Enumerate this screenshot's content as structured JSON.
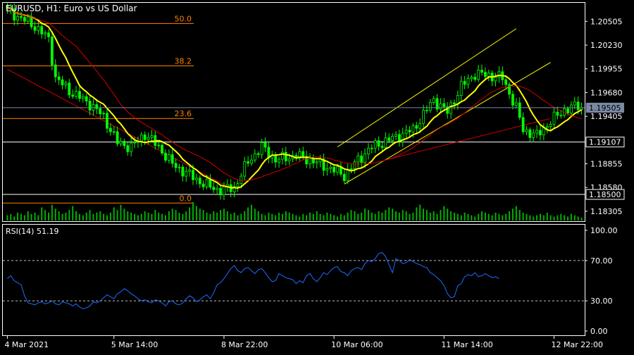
{
  "header": {
    "symbol": "EURUSD",
    "timeframe": "H1",
    "description": "Euro vs US Dollar"
  },
  "colors": {
    "background": "#000000",
    "frame": "#ffffff",
    "bull_candle": "#00ff00",
    "bear_candle": "#00ff00",
    "ma_fast": "#ffff00",
    "ma_slow": "#d40000",
    "fibo": "#ff8000",
    "channel": "#ffff00",
    "regression": "#d40000",
    "hline": "#ffffff",
    "current_price_line": "#7a8aa6",
    "volume": "#00b000",
    "rsi": "#1e6cff",
    "rsi_levels": "#c0c0c0"
  },
  "chart_data": [
    {
      "type": "candlestick",
      "title": "EURUSD, H1:  Euro vs US Dollar",
      "y_ticks": [
        "1.20505",
        "1.20230",
        "1.19955",
        "1.19680",
        "1.19405",
        "1.18855",
        "1.18580",
        "1.18305"
      ],
      "ylim": [
        1.1819,
        1.2072
      ],
      "x_ticks": [
        "4 Mar 2021",
        "5 Mar 14:00",
        "8 Mar 22:00",
        "10 Mar 06:00",
        "11 Mar 14:00",
        "12 Mar 22:00"
      ],
      "x_tick_index": [
        0,
        31,
        63,
        95,
        127,
        159
      ],
      "bar_count": 168,
      "price_path": [
        [
          0,
          1.2063
        ],
        [
          8,
          1.2045
        ],
        [
          12,
          1.203
        ],
        [
          14,
          1.1985
        ],
        [
          18,
          1.197
        ],
        [
          24,
          1.1955
        ],
        [
          28,
          1.194
        ],
        [
          32,
          1.191
        ],
        [
          36,
          1.1905
        ],
        [
          40,
          1.192
        ],
        [
          44,
          1.1905
        ],
        [
          48,
          1.1885
        ],
        [
          54,
          1.187
        ],
        [
          58,
          1.186
        ],
        [
          62,
          1.1855
        ],
        [
          66,
          1.1858
        ],
        [
          70,
          1.1888
        ],
        [
          74,
          1.1905
        ],
        [
          78,
          1.189
        ],
        [
          84,
          1.1895
        ],
        [
          88,
          1.189
        ],
        [
          94,
          1.188
        ],
        [
          98,
          1.1872
        ],
        [
          102,
          1.189
        ],
        [
          106,
          1.1905
        ],
        [
          112,
          1.1915
        ],
        [
          118,
          1.1925
        ],
        [
          124,
          1.196
        ],
        [
          128,
          1.1945
        ],
        [
          132,
          1.1975
        ],
        [
          136,
          1.199
        ],
        [
          140,
          1.1988
        ],
        [
          144,
          1.1985
        ],
        [
          148,
          1.195
        ],
        [
          150,
          1.1925
        ],
        [
          154,
          1.1918
        ],
        [
          158,
          1.1935
        ],
        [
          162,
          1.1948
        ],
        [
          166,
          1.1953
        ],
        [
          167,
          1.195
        ]
      ],
      "volume": [
        4,
        5,
        3,
        6,
        5,
        4,
        7,
        5,
        6,
        4,
        10,
        8,
        6,
        12,
        9,
        7,
        5,
        6,
        8,
        11,
        7,
        5,
        4,
        6,
        8,
        5,
        6,
        7,
        5,
        4,
        6,
        10,
        8,
        12,
        9,
        7,
        6,
        5,
        4,
        5,
        7,
        6,
        5,
        8,
        6,
        5,
        4,
        7,
        9,
        8,
        6,
        5,
        7,
        10,
        14,
        11,
        9,
        8,
        6,
        5,
        7,
        6,
        8,
        9,
        7,
        5,
        6,
        4,
        5,
        7,
        10,
        12,
        9,
        7,
        5,
        4,
        6,
        5,
        4,
        6,
        5,
        7,
        6,
        5,
        4,
        3,
        5,
        4,
        6,
        5,
        7,
        5,
        4,
        6,
        5,
        4,
        3,
        5,
        4,
        6,
        8,
        7,
        5,
        6,
        9,
        8,
        6,
        5,
        7,
        6,
        8,
        10,
        9,
        7,
        6,
        8,
        7,
        5,
        6,
        10,
        12,
        9,
        8,
        6,
        7,
        5,
        8,
        11,
        9,
        7,
        6,
        5,
        4,
        6,
        5,
        4,
        3,
        5,
        7,
        6,
        5,
        4,
        6,
        5,
        4,
        5,
        7,
        9,
        11,
        8,
        6,
        5,
        4,
        3,
        4,
        5,
        4,
        6,
        4,
        3,
        4,
        5,
        4,
        3,
        5,
        4,
        3,
        2
      ],
      "moving_averages": [
        {
          "kind": "fast",
          "period": 9
        },
        {
          "kind": "slow",
          "period": 21
        }
      ],
      "fibonacci": {
        "levels": [
          {
            "label": "50.0",
            "price": 1.2048
          },
          {
            "label": "38.2",
            "price": 1.1999
          },
          {
            "label": "23.6",
            "price": 1.1938
          },
          {
            "label": "0.0",
            "price": 1.184
          }
        ]
      },
      "horizontal_lines": [
        {
          "label": "1.19107",
          "price": 1.19107
        },
        {
          "label": "1.18500",
          "price": 1.185
        }
      ],
      "current_price": {
        "label": "1.19505",
        "price": 1.19505
      },
      "channel": {
        "upper": [
          [
            96,
            1.1905
          ],
          [
            148,
            1.2042
          ]
        ],
        "lower": [
          [
            98,
            1.1862
          ],
          [
            158,
            1.2003
          ]
        ],
        "mid_end": [
          [
            110,
            1.189
          ],
          [
            158,
            1.1938
          ]
        ]
      },
      "regression_line": [
        [
          0,
          1.1995
        ],
        [
          66,
          1.1855
        ]
      ]
    },
    {
      "type": "line",
      "title": "RSI(14) 51.19",
      "name": "RSI(14)",
      "value_label": "51.19",
      "ylim": [
        0,
        100
      ],
      "y_ticks": [
        "100.00",
        "70.00",
        "30.00",
        "0.00"
      ],
      "levels": [
        70,
        30
      ],
      "values": [
        52,
        55,
        50,
        48,
        46,
        35,
        28,
        27,
        26,
        28,
        29,
        27,
        28,
        30,
        27,
        26,
        29,
        28,
        27,
        25,
        27,
        24,
        22,
        23,
        25,
        29,
        28,
        30,
        33,
        36,
        34,
        32,
        37,
        39,
        42,
        40,
        37,
        35,
        32,
        30,
        31,
        29,
        28,
        31,
        30,
        28,
        25,
        29,
        30,
        27,
        26,
        28,
        32,
        35,
        33,
        29,
        31,
        34,
        36,
        32,
        38,
        46,
        48,
        52,
        57,
        62,
        65,
        60,
        58,
        62,
        63,
        60,
        57,
        61,
        62,
        58,
        53,
        49,
        50,
        57,
        55,
        53,
        52,
        51,
        47,
        50,
        48,
        55,
        57,
        52,
        49,
        53,
        58,
        56,
        60,
        63,
        64,
        59,
        58,
        55,
        60,
        62,
        63,
        61,
        67,
        70,
        69,
        72,
        77,
        78,
        74,
        66,
        58,
        72,
        70,
        67,
        68,
        71,
        69,
        67,
        66,
        64,
        63,
        58,
        56,
        53,
        50,
        45,
        37,
        33,
        34,
        45,
        47,
        54,
        56,
        55,
        58,
        54,
        55,
        57,
        55,
        53,
        54,
        52
      ]
    }
  ]
}
